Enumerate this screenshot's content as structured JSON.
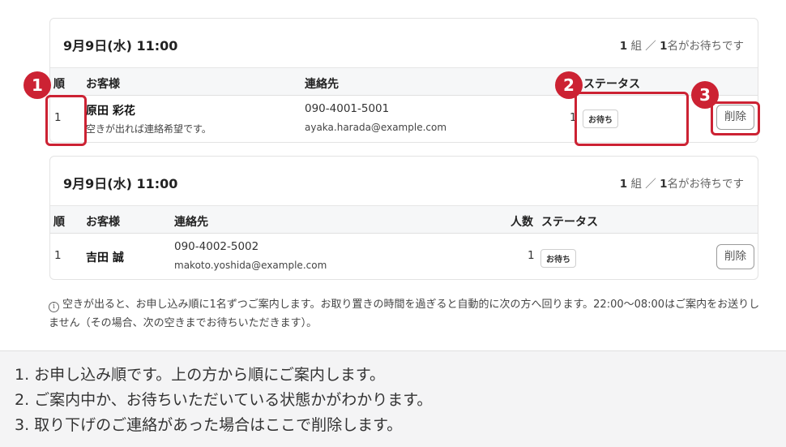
{
  "card1": {
    "title": "9月9日(水) 11:00",
    "count_groups": "1",
    "count_groups_unit": "組 ／",
    "count_people": "1",
    "count_people_unit": "名がお待ちです",
    "headers": {
      "order": "順",
      "customer": "お客様",
      "contact": "連絡先",
      "status": "ステータス"
    },
    "row": {
      "order": "1",
      "name": "原田 彩花",
      "note": "空きが出れば連絡希望です。",
      "phone": "090-4001-5001",
      "email": "ayaka.harada@example.com",
      "people": "1",
      "status": "お待ち",
      "delete_label": "削除"
    }
  },
  "card2": {
    "title": "9月9日(水) 11:00",
    "count_groups": "1",
    "count_groups_unit": "組 ／",
    "count_people": "1",
    "count_people_unit": "名がお待ちです",
    "headers": {
      "order": "順",
      "customer": "お客様",
      "contact": "連絡先",
      "people": "人数",
      "status": "ステータス"
    },
    "row": {
      "order": "1",
      "name": "吉田 誠",
      "phone": "090-4002-5002",
      "email": "makoto.yoshida@example.com",
      "people": "1",
      "status": "お待ち",
      "delete_label": "削除"
    }
  },
  "notice": {
    "icon": "info-icon",
    "text": "空きが出ると、お申し込み順に1名ずつご案内します。お取り置きの時間を過ぎると自動的に次の方へ回ります。22:00〜08:00はご案内をお送りしません（その場合、次の空きまでお待ちいただきます）。"
  },
  "markers": [
    "1",
    "2",
    "3"
  ],
  "legend": [
    "1. お申し込み順です。上の方から順にご案内します。",
    "2. ご案内中か、お待ちいただいている状態かがわかります。",
    "3. 取り下げのご連絡があった場合はここで削除します。"
  ],
  "colors": {
    "highlight": "#cc2233",
    "legend_bg": "#f4f4f5"
  }
}
